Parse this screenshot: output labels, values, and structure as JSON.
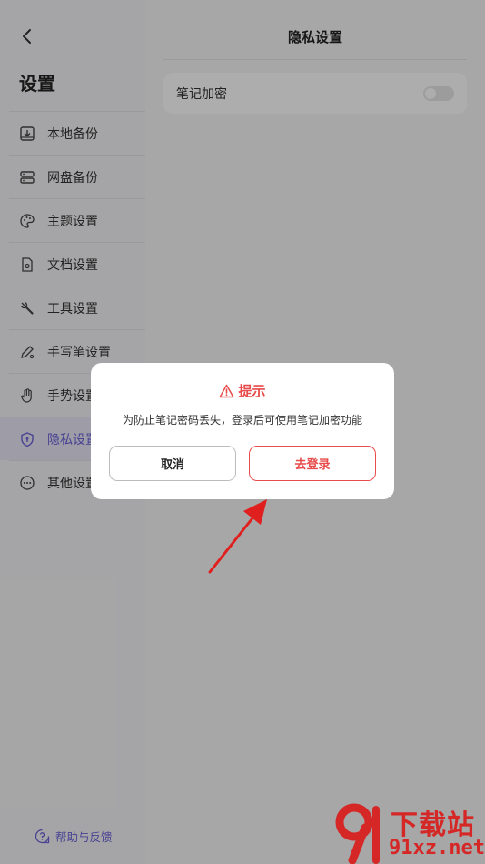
{
  "sidebar": {
    "title": "设置",
    "items": [
      {
        "label": "本地备份",
        "icon": "local-backup-icon"
      },
      {
        "label": "网盘备份",
        "icon": "cloud-backup-icon"
      },
      {
        "label": "主题设置",
        "icon": "palette-icon"
      },
      {
        "label": "文档设置",
        "icon": "document-icon"
      },
      {
        "label": "工具设置",
        "icon": "wrench-icon"
      },
      {
        "label": "手写笔设置",
        "icon": "pen-icon"
      },
      {
        "label": "手势设置",
        "icon": "hand-icon"
      },
      {
        "label": "隐私设置",
        "icon": "shield-icon",
        "active": true
      },
      {
        "label": "其他设置",
        "icon": "more-icon"
      }
    ],
    "help": "帮助与反馈"
  },
  "main": {
    "title": "隐私设置",
    "settings": [
      {
        "label": "笔记加密",
        "enabled": false
      }
    ]
  },
  "dialog": {
    "title": "提示",
    "message": "为防止笔记密码丢失，登录后可使用笔记加密功能",
    "cancel_label": "取消",
    "confirm_label": "去登录"
  },
  "watermark": {
    "line1": "下载站",
    "line2": "91xz.net"
  },
  "colors": {
    "accent": "#6a62d8",
    "danger": "#e84b4b",
    "annotation": "#e01f1f"
  }
}
